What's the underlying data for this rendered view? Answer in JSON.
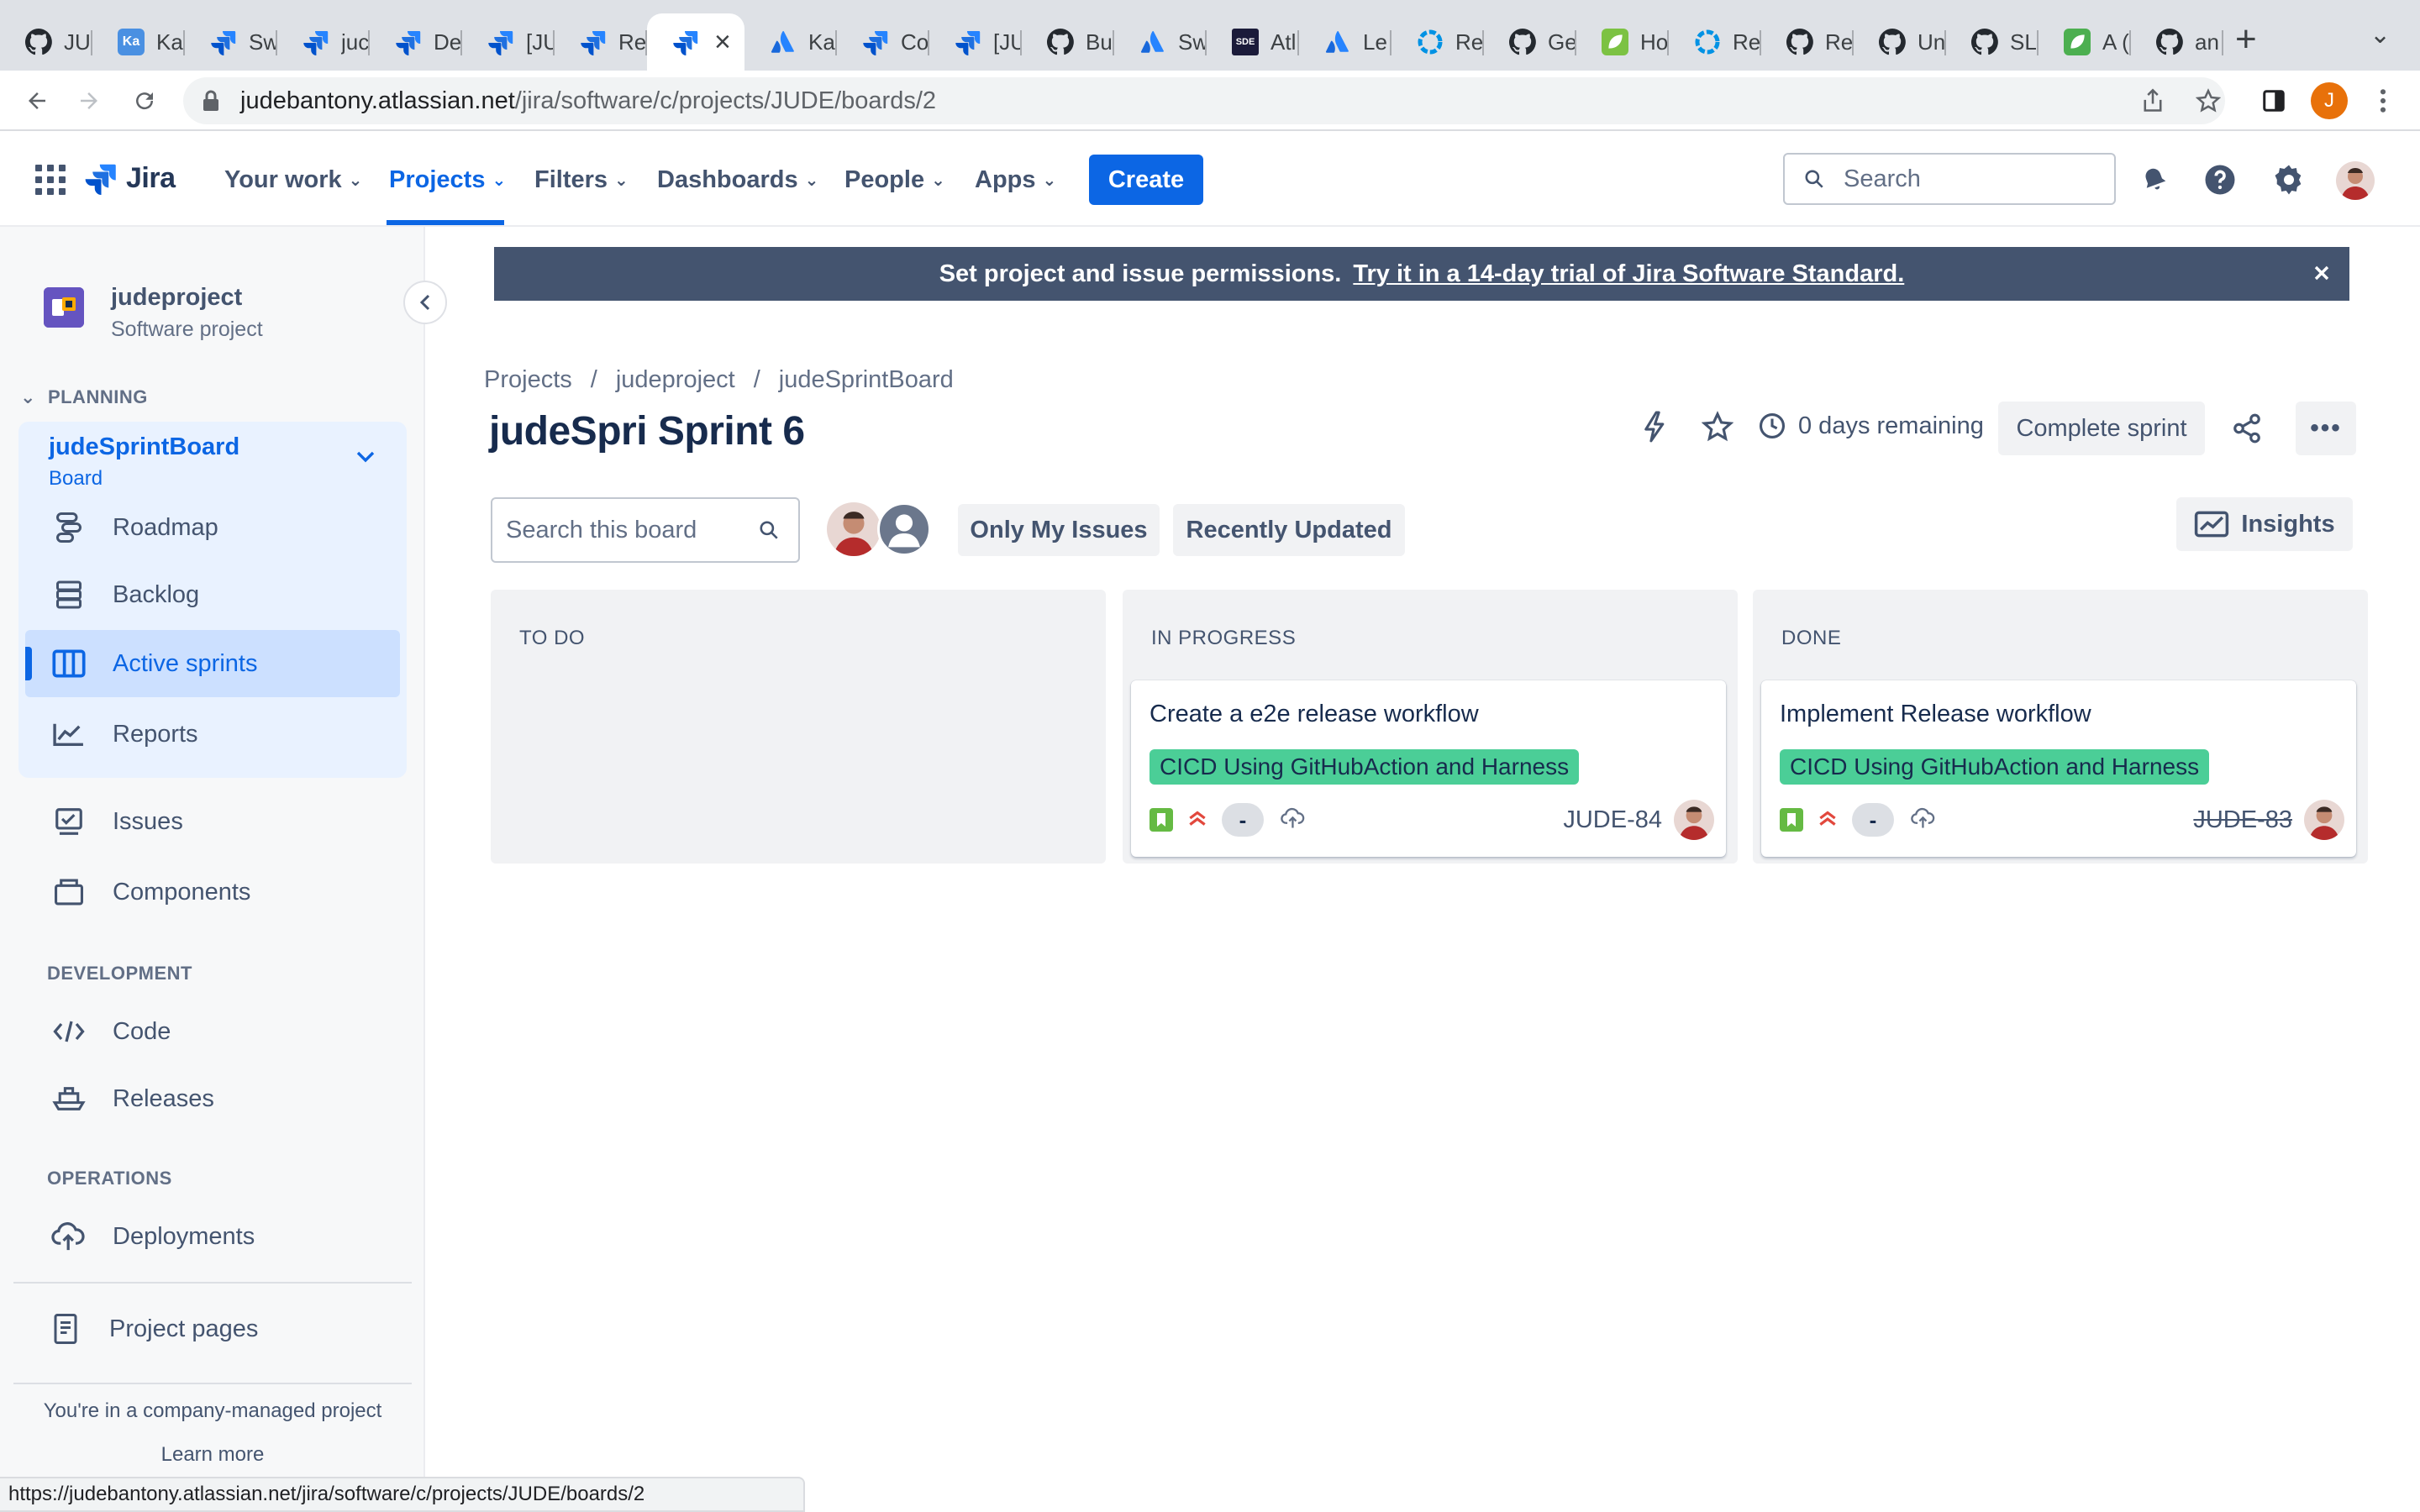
{
  "browser": {
    "tabs": [
      {
        "label": "JU",
        "icon": "github-icon",
        "color": "#24292f"
      },
      {
        "label": "Ka",
        "icon": "kanban-icon",
        "color": "#4a90e2"
      },
      {
        "label": "Sw",
        "icon": "jira-icon",
        "color": "#1868db"
      },
      {
        "label": "juc",
        "icon": "jira-icon",
        "color": "#1868db"
      },
      {
        "label": "De",
        "icon": "jira-icon",
        "color": "#1868db"
      },
      {
        "label": "[JU",
        "icon": "jira-icon",
        "color": "#1868db"
      },
      {
        "label": "Re",
        "icon": "jira-icon",
        "color": "#1868db"
      },
      {
        "label": "",
        "icon": "jira-icon",
        "color": "#1868db",
        "active": true
      },
      {
        "label": "Ka",
        "icon": "atlassian-icon",
        "color": "#1868db"
      },
      {
        "label": "Co",
        "icon": "jira-icon",
        "color": "#1868db"
      },
      {
        "label": "[JU",
        "icon": "jira-icon",
        "color": "#1868db"
      },
      {
        "label": "Bu",
        "icon": "github-icon",
        "color": "#24292f"
      },
      {
        "label": "Sw",
        "icon": "atlassian-icon",
        "color": "#1868db"
      },
      {
        "label": "Atl",
        "icon": "sde-icon",
        "color": "#1b1b3a",
        "text": "SDE"
      },
      {
        "label": "Le",
        "icon": "atlassian-icon",
        "color": "#1868db"
      },
      {
        "label": "Re",
        "icon": "harness-icon",
        "color": "#0092e4"
      },
      {
        "label": "Ge",
        "icon": "github-icon",
        "color": "#24292f"
      },
      {
        "label": "Ho",
        "icon": "leaf-icon",
        "color": "#7cc243"
      },
      {
        "label": "Re",
        "icon": "harness-icon",
        "color": "#0092e4"
      },
      {
        "label": "Re",
        "icon": "github-icon",
        "color": "#24292f"
      },
      {
        "label": "Un",
        "icon": "github-icon",
        "color": "#24292f"
      },
      {
        "label": "SL",
        "icon": "github-icon",
        "color": "#24292f"
      },
      {
        "label": "A (",
        "icon": "leaf-icon",
        "color": "#4caf50"
      },
      {
        "label": "an",
        "icon": "github-icon",
        "color": "#24292f"
      }
    ],
    "url_host": "judebantony.atlassian.net",
    "url_path": "/jira/software/c/projects/JUDE/boards/2",
    "profile_initial": "J",
    "status_url": "https://judebantony.atlassian.net/jira/software/c/projects/JUDE/boards/2"
  },
  "topnav": {
    "logo": "Jira",
    "items": [
      "Your work",
      "Projects",
      "Filters",
      "Dashboards",
      "People",
      "Apps"
    ],
    "create": "Create",
    "search_placeholder": "Search"
  },
  "sidebar": {
    "project_name": "judeproject",
    "project_type": "Software project",
    "planning_heading": "PLANNING",
    "board_name": "judeSprintBoard",
    "board_type": "Board",
    "planning_items": [
      "Roadmap",
      "Backlog",
      "Active sprints",
      "Reports"
    ],
    "other_items": [
      "Issues",
      "Components"
    ],
    "development_heading": "DEVELOPMENT",
    "development_items": [
      "Code",
      "Releases"
    ],
    "operations_heading": "OPERATIONS",
    "operations_items": [
      "Deployments"
    ],
    "project_pages": "Project pages",
    "company_note": "You're in a company-managed project",
    "learn_more": "Learn more"
  },
  "banner": {
    "text": "Set project and issue permissions.",
    "link": "Try it in a 14-day trial of Jira Software Standard."
  },
  "main": {
    "breadcrumbs": [
      "Projects",
      "judeproject",
      "judeSprintBoard"
    ],
    "sprint_title": "judeSpri Sprint 6",
    "days_remaining": "0 days remaining",
    "complete_sprint": "Complete sprint",
    "more": "•••",
    "board_search_placeholder": "Search this board",
    "filters": [
      "Only My Issues",
      "Recently Updated"
    ],
    "insights": "Insights"
  },
  "columns": [
    {
      "title": "TO DO",
      "cards": []
    },
    {
      "title": "IN PROGRESS",
      "cards": [
        {
          "summary": "Create a e2e release workflow",
          "epic": "CICD Using GitHubAction and Harness",
          "estimate": "-",
          "key": "JUDE-84",
          "done": false
        }
      ]
    },
    {
      "title": "DONE",
      "cards": [
        {
          "summary": "Implement Release workflow",
          "epic": "CICD Using GitHubAction and Harness",
          "estimate": "-",
          "key": "JUDE-83",
          "done": true
        }
      ]
    }
  ],
  "colors": {
    "primary": "#0c66e4",
    "banner": "#44546f",
    "epic_green": "#4bce97",
    "story_green": "#65ba43",
    "priority_orange": "#e2483d"
  }
}
